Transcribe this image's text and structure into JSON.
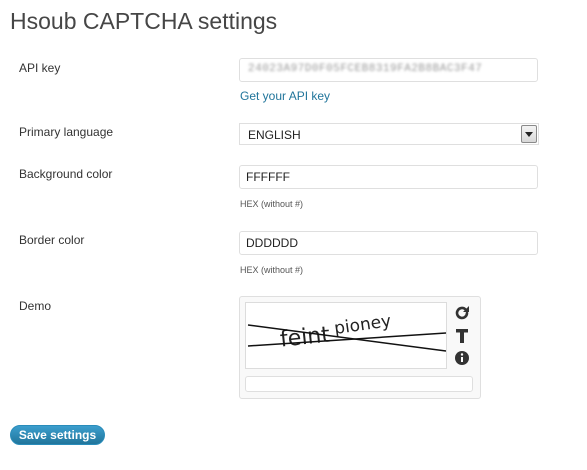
{
  "page": {
    "title": "Hsoub CAPTCHA settings"
  },
  "fields": {
    "api_key": {
      "label": "API key",
      "value": "24023A97D0F05FCEB8319FA2B8BAC3F47",
      "link_text": "Get your API key"
    },
    "primary_language": {
      "label": "Primary language",
      "selected": "ENGLISH"
    },
    "background_color": {
      "label": "Background color",
      "value": "FFFFFF",
      "hint": "HEX (without #)"
    },
    "border_color": {
      "label": "Border color",
      "value": "DDDDDD",
      "hint": "HEX (without #)"
    },
    "demo": {
      "label": "Demo",
      "captcha_word_1": "feint",
      "captcha_word_2": "pioney",
      "icons": [
        "refresh-icon",
        "text-icon",
        "info-icon"
      ],
      "answer_value": ""
    }
  },
  "actions": {
    "save_label": "Save settings"
  },
  "colors": {
    "link": "#21759b",
    "button": "#21759b",
    "border": "#dfdfdf"
  }
}
